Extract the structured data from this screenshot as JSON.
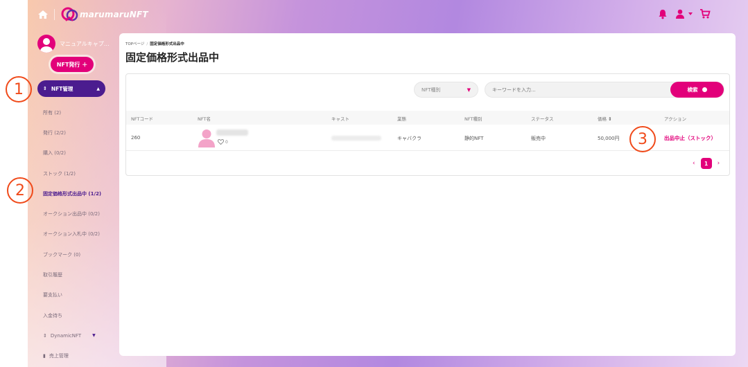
{
  "header": {
    "logo_text": "marumaruNFT",
    "icons": [
      "home-icon",
      "notification-icon",
      "user-icon",
      "chevron-down-icon",
      "cart-icon"
    ],
    "accent": "#e2007a"
  },
  "sidebar": {
    "user_name": "マニュアルキャプ…",
    "issue_button": "NFT発行 ＋",
    "nft_manage": "NFT管理",
    "items": [
      {
        "label": "所有 (2)"
      },
      {
        "label": "発行 (2/2)"
      },
      {
        "label": "購入 (0/2)"
      },
      {
        "label": "ストック (1/2)"
      },
      {
        "label": "固定価格形式出品中 (1/2)"
      },
      {
        "label": "オークション出品中 (0/2)"
      },
      {
        "label": "オークション入札中 (0/2)"
      },
      {
        "label": "ブックマーク (0)"
      },
      {
        "label": "取引履歴"
      },
      {
        "label": "要支払い"
      },
      {
        "label": "入金待ち"
      },
      {
        "label": "DynamicNFT"
      },
      {
        "label": "売上管理"
      }
    ]
  },
  "main": {
    "breadcrumb": {
      "home": "TOPページ",
      "current": "固定価格形式出品中"
    },
    "title": "固定価格形式出品中",
    "filter": {
      "type_placeholder": "NFT種別",
      "keyword_placeholder": "キーワードを入力...",
      "search_label": "検索"
    },
    "columns": [
      "NFTコード",
      "NFT名",
      "キャスト",
      "業態",
      "NFT種別",
      "ステータス",
      "価格",
      "アクション"
    ],
    "sort_icon": "sort-icon",
    "rows": [
      {
        "code": "260",
        "likes": "0",
        "business": "キャバクラ",
        "type": "静的NFT",
        "status": "販売中",
        "price": "50,000円",
        "action": "出品中止（ストック）"
      }
    ],
    "pagination": {
      "current": "1"
    }
  },
  "annotations": [
    "1",
    "2",
    "3"
  ]
}
